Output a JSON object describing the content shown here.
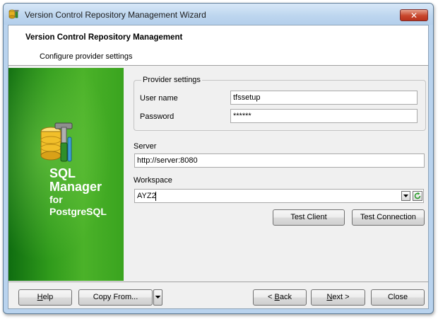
{
  "window": {
    "title": "Version Control Repository Management Wizard",
    "close_glyph": "✕"
  },
  "header": {
    "title": "Version Control Repository Management",
    "subtitle": "Configure provider settings"
  },
  "banner": {
    "line1": "SQL",
    "line2": "Manager",
    "line3": "for",
    "line4": "PostgreSQL"
  },
  "provider": {
    "group_label": "Provider settings",
    "user_label": "User name",
    "user_value": "tfssetup",
    "password_label": "Password",
    "password_value": "******"
  },
  "server": {
    "label": "Server",
    "value": "http://server:8080"
  },
  "workspace": {
    "label": "Workspace",
    "value": "AYZ2"
  },
  "buttons": {
    "test_client": "Test Client",
    "test_connection": "Test Connection",
    "help_mn": "H",
    "help_rest": "elp",
    "copy_from": "Copy From...",
    "back_pre": "< ",
    "back_mn": "B",
    "back_rest": "ack",
    "next_mn": "N",
    "next_rest": "ext >",
    "close": "Close"
  },
  "icons": {
    "app": "database-tools-icon",
    "banner": "database-tools-icon",
    "dropdown": "chevron-down-icon",
    "refresh": "refresh-icon"
  },
  "colors": {
    "banner_green": "#3aa41f",
    "titlebar": "#bcd5ee",
    "close_red": "#c8472c"
  }
}
